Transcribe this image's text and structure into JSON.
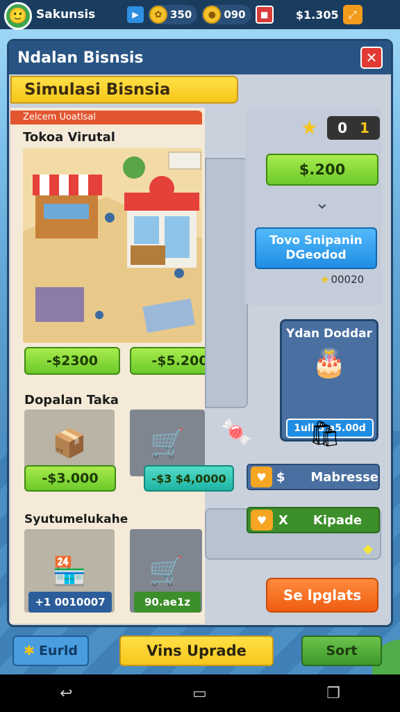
{
  "status_bar": {
    "player_name": "Sakunsis",
    "play_icon": "play-icon",
    "gems": "350",
    "coins": "090",
    "money": "$1.305",
    "expand_icon": "expand-icon"
  },
  "panel": {
    "title": "Ndalan Bisnsis",
    "close_icon": "close-icon",
    "banner": "Simulasi Bisnsia",
    "subtab": "Zelcem Uoatlsal"
  },
  "sections": {
    "virtual_shop": {
      "title": "Tokoa Virutal",
      "price_a": "-$2300",
      "price_b": "-$5.200"
    },
    "shop_items": {
      "title": "Dopalan Taka",
      "price_a": "-$3.000",
      "price_b": "-$3 $4,0000"
    },
    "upgrades": {
      "title": "Syutumelukahe",
      "value_a": "+1 0010007",
      "value_b": "90.ae1z"
    }
  },
  "right": {
    "counter_left": "0",
    "counter_right": "1",
    "price_button": "$.200",
    "blue_button_line1": "Tovo Snipanin",
    "blue_button_line2": "DGeodod",
    "star_value": "00020",
    "reward_title": "Ydan Doddar",
    "reward_value": "1ull S.a5.00d",
    "mabresse": "Mabresse",
    "kipade": "Kipade",
    "row_x": "X",
    "sale_button": "Se lpglats"
  },
  "bottom_bar": {
    "edit_label": "Eurld",
    "upgrade_label": "Vins Uprade",
    "start_label": "Sort"
  },
  "colors": {
    "accent_green": "#6cc92a",
    "accent_blue": "#1f8de3",
    "accent_orange": "#ef5d12",
    "panel_dark": "#22476e",
    "banner_yellow": "#f6c71b"
  }
}
